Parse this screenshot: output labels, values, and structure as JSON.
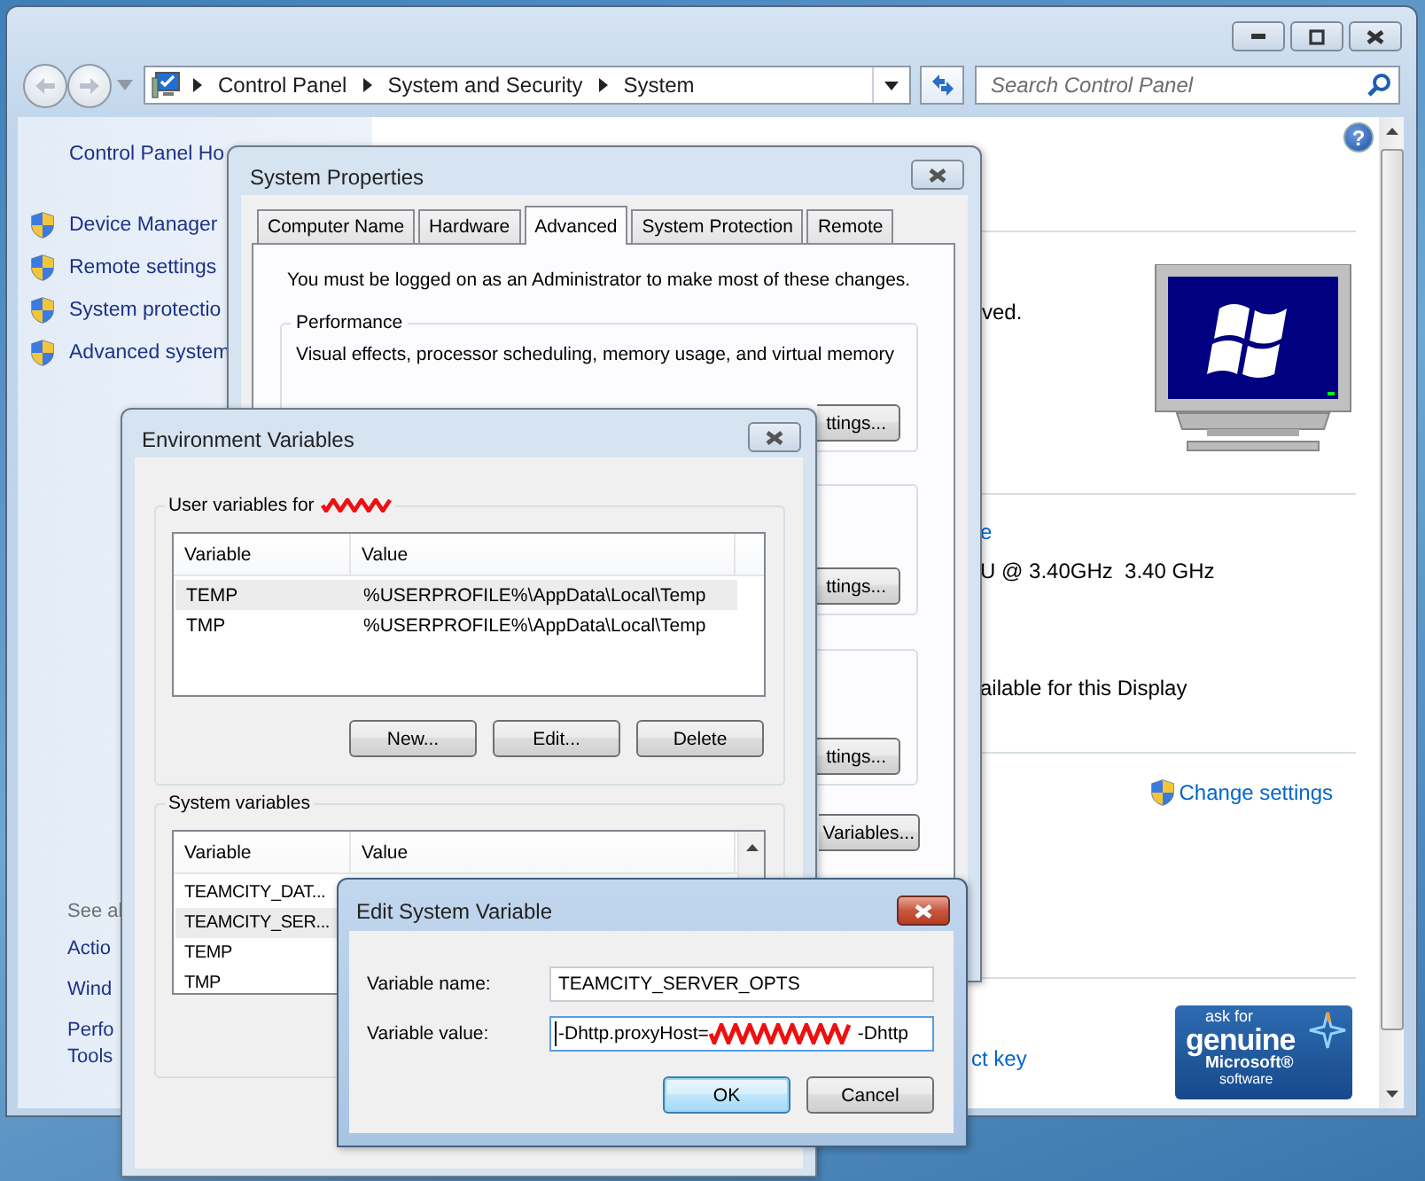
{
  "control_panel": {
    "breadcrumb": [
      "Control Panel",
      "System and Security",
      "System"
    ],
    "search": {
      "placeholder": "Search Control Panel"
    },
    "help_button": "?",
    "sidebar": {
      "home_link": "Control Panel Ho",
      "tasks": [
        "Device Manager",
        "Remote settings",
        "System protectio",
        "Advanced system"
      ],
      "see_also_heading": "See al",
      "see_also": [
        {
          "lines": [
            "Actio"
          ]
        },
        {
          "lines": [
            "Wind"
          ]
        },
        {
          "lines": [
            "Perfo",
            "Tools"
          ]
        }
      ]
    },
    "content": {
      "edition_fragment": "ved.",
      "link_fragment": "e",
      "processor_fragment": "U @ 3.40GHz  3.40 GHz",
      "display_fragment": "ailable for this Display",
      "change_settings_link": "Change settings",
      "product_key_fragment": "ct key",
      "genuine_badge": {
        "top": "ask for",
        "main": "genuine",
        "brand": "Microsoft®",
        "bottom": "software"
      }
    }
  },
  "system_properties": {
    "title": "System Properties",
    "tabs": [
      {
        "label": "Computer Name",
        "selected": false
      },
      {
        "label": "Hardware",
        "selected": false
      },
      {
        "label": "Advanced",
        "selected": true
      },
      {
        "label": "System Protection",
        "selected": false
      },
      {
        "label": "Remote",
        "selected": false
      }
    ],
    "notice": "You must be logged on as an Administrator to make most of these changes.",
    "performance": {
      "heading": "Performance",
      "description": "Visual effects, processor scheduling, memory usage, and virtual memory",
      "button": "ttings..."
    },
    "group_buttons": [
      "ttings...",
      "ttings..."
    ],
    "variables_button": "Variables..."
  },
  "environment_variables": {
    "title": "Environment Variables",
    "user_variables": {
      "heading": "User variables for",
      "columns": [
        "Variable",
        "Value"
      ],
      "rows": [
        {
          "variable": "TEMP",
          "value": "%USERPROFILE%\\AppData\\Local\\Temp",
          "selected": true
        },
        {
          "variable": "TMP",
          "value": "%USERPROFILE%\\AppData\\Local\\Temp",
          "selected": false
        }
      ],
      "buttons": [
        "New...",
        "Edit...",
        "Delete"
      ]
    },
    "system_variables": {
      "heading": "System variables",
      "columns": [
        "Variable",
        "Value"
      ],
      "rows": [
        {
          "variable": "TEAMCITY_DAT...",
          "selected": false
        },
        {
          "variable": "TEAMCITY_SER...",
          "selected": true
        },
        {
          "variable": "TEMP",
          "selected": false
        },
        {
          "variable": "TMP",
          "selected": false
        }
      ]
    }
  },
  "edit_variable": {
    "title": "Edit System Variable",
    "name_label": "Variable name:",
    "name_value": "TEAMCITY_SERVER_OPTS",
    "value_label": "Variable value:",
    "value_before": "-Dhttp.proxyHost=",
    "value_after": "-Dhttp",
    "buttons": [
      {
        "label": "OK",
        "default": true
      },
      {
        "label": "Cancel",
        "default": false
      }
    ]
  }
}
